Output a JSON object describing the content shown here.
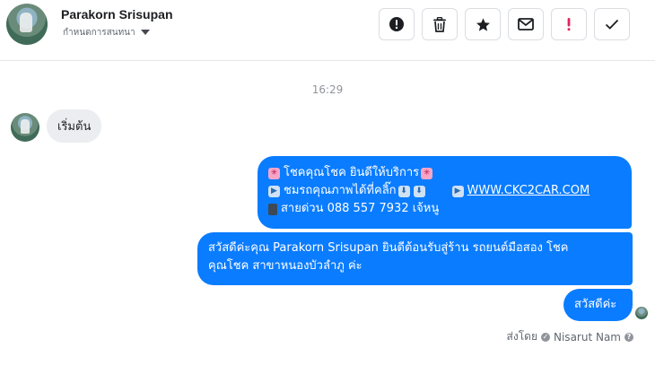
{
  "header": {
    "contact_name": "Parakorn Srisupan",
    "label_dropdown": "กำหนดการสนทนา",
    "toolbar": [
      {
        "icon": "exclamation-circle-icon",
        "name": "mark-spam-button"
      },
      {
        "icon": "trash-icon",
        "name": "delete-button"
      },
      {
        "icon": "star-icon",
        "name": "star-button"
      },
      {
        "icon": "envelope-icon",
        "name": "mark-unread-button"
      },
      {
        "icon": "exclamation-icon",
        "name": "follow-up-button"
      },
      {
        "icon": "checkmark-icon",
        "name": "mark-done-button"
      }
    ]
  },
  "conversation": {
    "timestamp": "16:29",
    "incoming": {
      "text": "เริ่มต้น"
    },
    "outgoing": [
      {
        "lines": [
          "โชคคุณโชค ยินดีให้บริการ",
          "ชมรถคุณภาพได้ที่คลิ๊ก",
          "WWW.CKC2CAR.COM",
          "สายด่วน 088 557 7932 เจ้หนู"
        ]
      },
      {
        "line1": "สวัสดีค่ะคุณ Parakorn Srisupan ยินดีต้อนรับสู่ร้าน รถยนต์มือสอง โชค",
        "line2": "คุณโชค สาขาหนองบัวลำภู ค่ะ"
      },
      {
        "text": "สวัสดีค่ะ"
      }
    ],
    "sent_by_label": "ส่งโดย",
    "sent_by_name": "Nisarut Nam"
  },
  "colors": {
    "outgoing_bubble": "#0a7cff",
    "incoming_bubble": "#ebedf0",
    "follow_up_icon": "#e0245e"
  }
}
